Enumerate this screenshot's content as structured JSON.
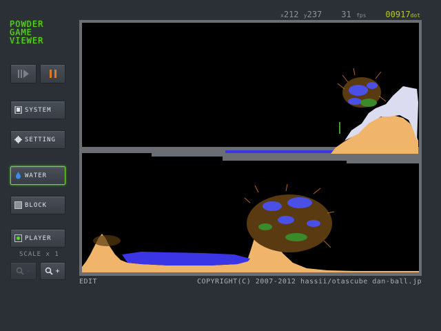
{
  "logo": {
    "line1": "POWDER",
    "line2": "GAME",
    "line3": "VIEWER"
  },
  "status": {
    "x_label": "x",
    "x_value": "212",
    "y_label": "y",
    "y_value": "237",
    "fps_value": "31",
    "fps_label": "fps",
    "dot_value": "00917",
    "dot_label": "dot"
  },
  "buttons": {
    "system": "SYSTEM",
    "setting": "SETTING",
    "water": "WATER",
    "block": "BLOCK",
    "player": "PLAYER"
  },
  "scale": {
    "label": "SCALE",
    "value": "x 1"
  },
  "zoom": {
    "minus": "-",
    "plus": "+"
  },
  "footer": {
    "edit": "EDIT",
    "copyright": "COPYRIGHT(C) 2007-2012 hassii/otascube dan-ball.jp"
  },
  "colors": {
    "accent_green": "#5fd92a",
    "pause_orange": "#e07a1e",
    "sand": "#f0b56b",
    "water": "#3a36e6",
    "cloud": "#dcdcf0",
    "wall": "#6b6e72"
  }
}
